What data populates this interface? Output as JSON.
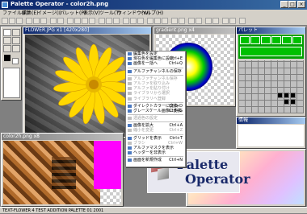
{
  "window": {
    "title": "Palette Operator - color2h.png"
  },
  "menu": {
    "items": [
      "ファイル(F)",
      "編集(E)",
      "イメージ(I)",
      "パレット(P)",
      "表示(V)",
      "ツール(T)",
      "ウィンドウ(W)",
      "ヘルプ(H)"
    ]
  },
  "image_windows": {
    "flower_title": "FLOWER.JPG x1 [420x280]",
    "gradient_title": "gradient.png x4",
    "pixel_title": "color2h.png x8"
  },
  "palette_window": {
    "title": "パレット"
  },
  "small_window": {
    "title": "情報"
  },
  "context_menu": {
    "items": [
      {
        "label": "編集色を設定",
        "shortcut": "",
        "enabled": true
      },
      {
        "label": "現在色を編集色に設定",
        "shortcut": "Ctrl+E",
        "enabled": true
      },
      {
        "label": "画像を一括へ",
        "shortcut": "Ctrl+Q",
        "enabled": true
      },
      {
        "label": "アルファチャンネルの保存",
        "shortcut": "",
        "enabled": true
      },
      {
        "label": "アルファチャンネル保存",
        "shortcut": "",
        "enabled": false
      },
      {
        "label": "アルファを取り込み",
        "shortcut": "",
        "enabled": false
      },
      {
        "label": "アルファを貼り付け",
        "shortcut": "",
        "enabled": false
      },
      {
        "label": "ライブラリから選択",
        "shortcut": "",
        "enabled": false
      },
      {
        "label": "ライブラリへ登録",
        "shortcut": "",
        "enabled": false
      },
      {
        "label": "ダイレクトカラーに変換",
        "shortcut": "Ctrl+D",
        "enabled": true
      },
      {
        "label": "グレースケール画像に変換",
        "shortcut": "Ctrl+G",
        "enabled": true
      },
      {
        "label": "透過色の設定",
        "shortcut": "",
        "enabled": false
      },
      {
        "label": "画像を拡大",
        "shortcut": "Ctrl+A",
        "enabled": true
      },
      {
        "label": "縮小を変更",
        "shortcut": "Ctrl+Z",
        "enabled": false
      },
      {
        "label": "グリッドを表示",
        "shortcut": "Ctrl+T",
        "enabled": true
      },
      {
        "label": "ブラシ",
        "shortcut": "Ctrl+W",
        "enabled": false
      },
      {
        "label": "アルファマスクを表示",
        "shortcut": "",
        "enabled": true
      },
      {
        "label": "ヘッダーを非表示",
        "shortcut": "",
        "enabled": true
      },
      {
        "label": "画面を新規作成",
        "shortcut": "Ctrl+N",
        "enabled": true
      }
    ]
  },
  "logo": {
    "line1": "Palette",
    "line2": "Operator"
  },
  "statusbar": {
    "text": "TEXT-FLOWER 4 TEST ADDITION PALETTE 01 2001"
  },
  "colors": {
    "title_active": "#0a246a",
    "face": "#d4d0c8",
    "palette_green": "#00a000",
    "magenta": "#ff00ff"
  }
}
